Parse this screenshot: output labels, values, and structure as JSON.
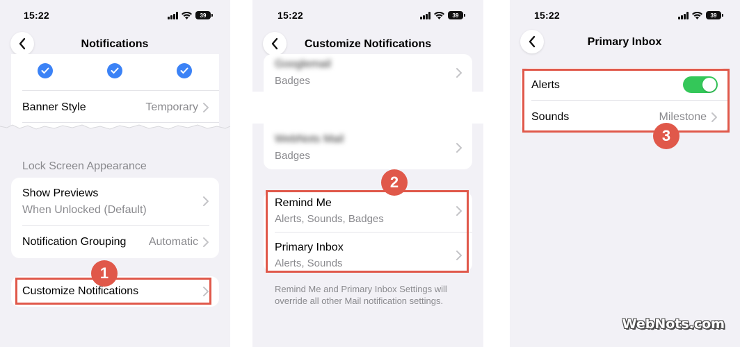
{
  "status": {
    "time": "15:22",
    "battery": "39"
  },
  "panel1": {
    "title": "Notifications",
    "banner_style": {
      "label": "Banner Style",
      "value": "Temporary"
    },
    "section_header": "Lock Screen Appearance",
    "show_previews": {
      "label": "Show Previews",
      "sub": "When Unlocked (Default)"
    },
    "notification_grouping": {
      "label": "Notification Grouping",
      "value": "Automatic"
    },
    "customize": {
      "label": "Customize Notifications"
    },
    "step": "1"
  },
  "panel2": {
    "title": "Customize Notifications",
    "account_rows": [
      {
        "sub": "Badges"
      },
      {
        "sub": "Badges"
      }
    ],
    "remind_me": {
      "label": "Remind Me",
      "sub": "Alerts, Sounds, Badges"
    },
    "primary_inbox": {
      "label": "Primary Inbox",
      "sub": "Alerts, Sounds"
    },
    "footer": "Remind Me and Primary Inbox Settings will override all other Mail notification settings.",
    "step": "2"
  },
  "panel3": {
    "title": "Primary Inbox",
    "alerts": {
      "label": "Alerts",
      "on": true
    },
    "sounds": {
      "label": "Sounds",
      "value": "Milestone"
    },
    "step": "3"
  },
  "watermark": "WebNots.com",
  "colors": {
    "accent": "#e0584a",
    "toggle_on": "#34c759",
    "check": "#3b82f6",
    "background": "#f2f1f6"
  }
}
